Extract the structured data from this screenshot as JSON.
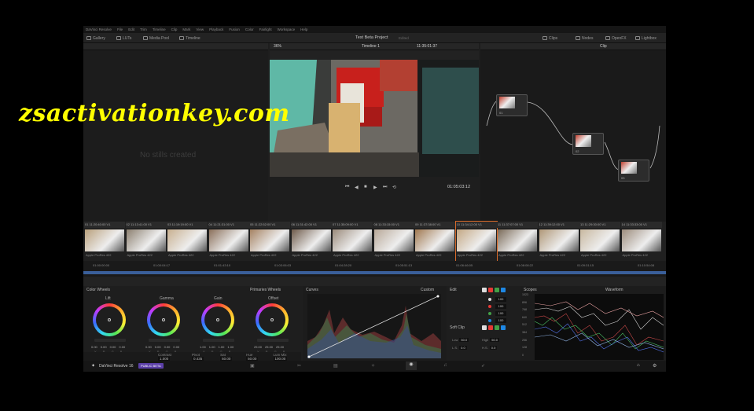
{
  "watermark": "zsactivationkey.com",
  "menu": [
    "DaVinci Resolve",
    "File",
    "Edit",
    "Trim",
    "Timeline",
    "Clip",
    "Mark",
    "View",
    "Playback",
    "Fusion",
    "Color",
    "Fairlight",
    "Workspace",
    "Help"
  ],
  "toolbar": {
    "gallery": "Gallery",
    "luts": "LUTs",
    "media_pool": "Media Pool",
    "timeline": "Timeline",
    "project_title": "Test Beta Project",
    "project_state": "Edited",
    "clips": "Clips",
    "nodes": "Nodes",
    "openfx": "OpenFX",
    "lightbox": "Lightbox"
  },
  "viewer": {
    "zoom": "36%",
    "timeline_name": "Timeline 1",
    "timecode_top": "11:35:01:37",
    "timecode": "01:05:03:12"
  },
  "node_panel": {
    "mode": "Clip"
  },
  "nodes": [
    {
      "label": "01"
    },
    {
      "label": "02"
    },
    {
      "label": "03"
    }
  ],
  "gallery": {
    "empty_text": "No stills created"
  },
  "clips": [
    {
      "num": "01",
      "tc": "11:20:40:00",
      "track": "V1",
      "name": "Apple ProRes 422"
    },
    {
      "num": "02",
      "tc": "11:13:41:00",
      "track": "V1",
      "name": "Apple ProRes 422"
    },
    {
      "num": "03",
      "tc": "11:19:19:00",
      "track": "V1",
      "name": "Apple ProRes 422"
    },
    {
      "num": "04",
      "tc": "11:21:31:00",
      "track": "V1",
      "name": "Apple ProRes 422"
    },
    {
      "num": "05",
      "tc": "11:22:52:00",
      "track": "V1",
      "name": "Apple ProRes 422"
    },
    {
      "num": "06",
      "tc": "11:31:42:00",
      "track": "V1",
      "name": "Apple ProRes 422"
    },
    {
      "num": "07",
      "tc": "11:35:09:00",
      "track": "V1",
      "name": "Apple ProRes 422"
    },
    {
      "num": "08",
      "tc": "11:33:15:00",
      "track": "V1",
      "name": "Apple ProRes 422"
    },
    {
      "num": "09",
      "tc": "11:37:38:00",
      "track": "V1",
      "name": "Apple ProRes 422"
    },
    {
      "num": "10",
      "tc": "11:34:12:00",
      "track": "V1",
      "name": "Apple ProRes 422"
    },
    {
      "num": "11",
      "tc": "11:37:07:00",
      "track": "V1",
      "name": "Apple ProRes 422"
    },
    {
      "num": "12",
      "tc": "11:39:12:00",
      "track": "V1",
      "name": "Apple ProRes 422"
    },
    {
      "num": "13",
      "tc": "11:29:30:00",
      "track": "V1",
      "name": "Apple ProRes 422"
    },
    {
      "num": "14",
      "tc": "11:33:33:00",
      "track": "V1",
      "name": "Apple ProRes 422"
    }
  ],
  "mini_timeline_ticks": [
    "01:00:00:00",
    "01:00:04:17",
    "01:01:43:10",
    "01:03:06:03",
    "01:04:28:20",
    "01:05:51:13",
    "01:06:46:05",
    "01:08:08:22",
    "01:09:31:15",
    "01:10:54:08"
  ],
  "color_wheels": {
    "title": "Color Wheels",
    "mode": "Primaries Wheels",
    "wheels": [
      {
        "name": "Lift",
        "values": [
          "0.00",
          "0.00",
          "0.00",
          "0.00"
        ]
      },
      {
        "name": "Gamma",
        "values": [
          "0.00",
          "0.00",
          "0.00",
          "0.00"
        ]
      },
      {
        "name": "Gain",
        "values": [
          "1.00",
          "1.00",
          "1.00",
          "1.00"
        ]
      },
      {
        "name": "Offset",
        "values": [
          "25.00",
          "25.00",
          "25.00",
          ""
        ]
      }
    ],
    "channels": [
      "Y",
      "R",
      "G",
      "B"
    ],
    "adjust": [
      {
        "label": "Contrast",
        "value": "1.000"
      },
      {
        "label": "Pivot",
        "value": "0.435"
      },
      {
        "label": "Sat",
        "value": "50.00"
      },
      {
        "label": "Hue",
        "value": "50.00"
      },
      {
        "label": "Lum Mix",
        "value": "100.00"
      }
    ]
  },
  "curves": {
    "title": "Curves",
    "mode": "Custom"
  },
  "edit": {
    "title": "Edit",
    "channels": [
      {
        "color": "#dddddd",
        "value": "100"
      },
      {
        "color": "#e53935",
        "value": "100"
      },
      {
        "color": "#43a047",
        "value": "100"
      },
      {
        "color": "#1e88e5",
        "value": "100"
      }
    ],
    "soft_clip": "Soft Clip",
    "low": {
      "label": "Low",
      "value": "50.0"
    },
    "high": {
      "label": "High",
      "value": "50.0"
    },
    "ls": {
      "label": "L.S.",
      "value": "0.0"
    },
    "hs": {
      "label": "H.S.",
      "value": "0.0"
    }
  },
  "scopes": {
    "title": "Scopes",
    "mode": "Waveform",
    "scale": [
      "1023",
      "896",
      "768",
      "640",
      "512",
      "384",
      "256",
      "128",
      "0"
    ]
  },
  "bottom": {
    "app": "DaVinci Resolve 16",
    "badge": "PUBLIC BETA"
  }
}
